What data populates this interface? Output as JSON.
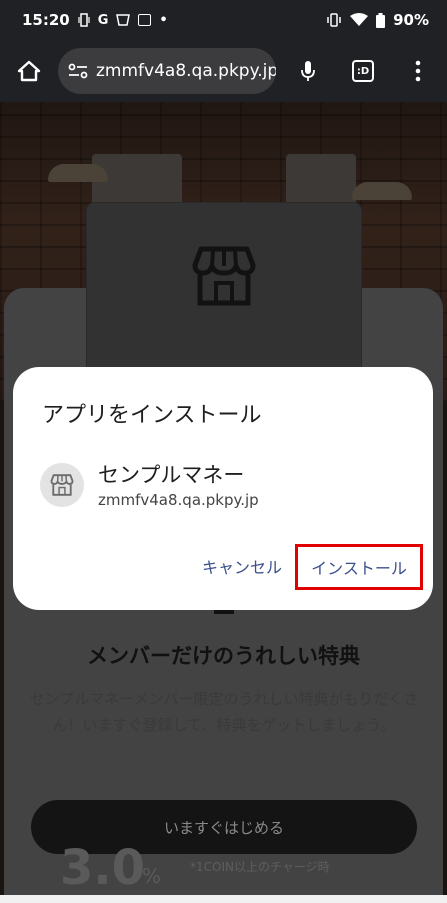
{
  "status_bar": {
    "time": "15:20",
    "app_letter": "G",
    "battery": "90%"
  },
  "browser": {
    "url": "zmmfv4a8.qa.pkpy.jp",
    "tab_label": ":D"
  },
  "page": {
    "member_title": "メンバーだけのうれしい特典",
    "member_desc": "センプルマネーメンバー限定のうれしい特典がもりだくさん！いますぐ登録して、特典をゲットしましょう。",
    "start_button": "いますぐはじめる",
    "big_number": "3.0",
    "big_unit": "%",
    "charge_note": "*1COIN以上のチャージ時"
  },
  "dialog": {
    "title": "アプリをインストール",
    "app_name": "センプルマネー",
    "app_url": "zmmfv4a8.qa.pkpy.jp",
    "cancel_label": "キャンセル",
    "install_label": "インストール",
    "highlight_color": "#e00000",
    "button_text_color": "#3a4f8c"
  }
}
